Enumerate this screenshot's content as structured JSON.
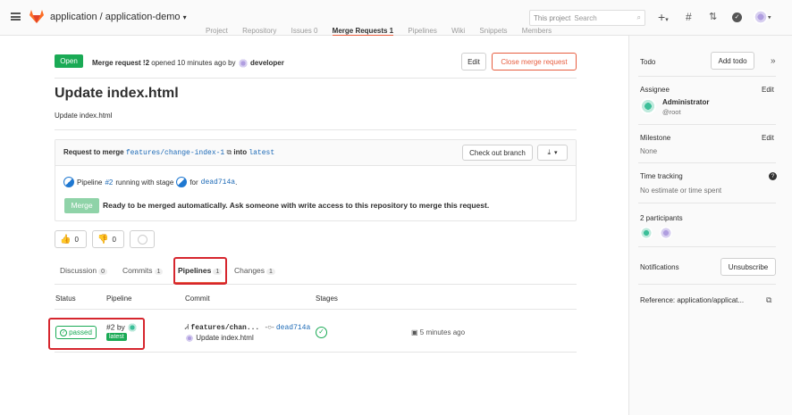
{
  "header": {
    "breadcrumb": "application / application-demo",
    "search_scope": "This project",
    "search_placeholder": "Search"
  },
  "subnav": {
    "items": [
      "Project",
      "Repository",
      "Issues 0",
      "Merge Requests 1",
      "Pipelines",
      "Wiki",
      "Snippets",
      "Members"
    ]
  },
  "mr": {
    "status": "Open",
    "ref": "Merge request !2",
    "opened": "opened 10 minutes ago by",
    "author": "developer",
    "edit_label": "Edit",
    "close_label": "Close merge request",
    "title": "Update index.html",
    "description": "Update index.html"
  },
  "widget": {
    "request_prefix": "Request to merge",
    "source_branch": "features/change-index-1",
    "into": "into",
    "target_branch": "latest",
    "checkout_label": "Check out branch",
    "pipeline_prefix": "Pipeline",
    "pipeline_id": "#2",
    "pipeline_status": "running with stage",
    "pipeline_for": "for",
    "commit_sha": "dead714a",
    "period": ".",
    "merge_label": "Merge",
    "merge_message": "Ready to be merged automatically. Ask someone with write access to this repository to merge this request."
  },
  "awards": {
    "thumbsup": "0",
    "thumbsdown": "0"
  },
  "tabs": [
    {
      "label": "Discussion",
      "count": "0"
    },
    {
      "label": "Commits",
      "count": "1"
    },
    {
      "label": "Pipelines",
      "count": "1"
    },
    {
      "label": "Changes",
      "count": "1"
    }
  ],
  "pipelines_table": {
    "headers": [
      "Status",
      "Pipeline",
      "Commit",
      "Stages"
    ],
    "row": {
      "status": "passed",
      "pipeline_id": "#2 by",
      "badge": "latest",
      "branch": "features/chan...",
      "sha": "dead714a",
      "commit_title": "Update index.html",
      "time": "5 minutes ago"
    }
  },
  "sidebar": {
    "todo_label": "Todo",
    "add_todo": "Add todo",
    "expand": "»",
    "assignee_label": "Assignee",
    "edit": "Edit",
    "assignee_name": "Administrator",
    "assignee_user": "@root",
    "milestone_label": "Milestone",
    "milestone_value": "None",
    "time_label": "Time tracking",
    "time_value": "No estimate or time spent",
    "participants": "2 participants",
    "notifications_label": "Notifications",
    "unsubscribe": "Unsubscribe",
    "reference": "Reference: application/applicat..."
  },
  "colors": {
    "green": "#1aaa55",
    "orange": "#e75e40",
    "link": "#1b69b6",
    "highlight": "#d6262e"
  }
}
